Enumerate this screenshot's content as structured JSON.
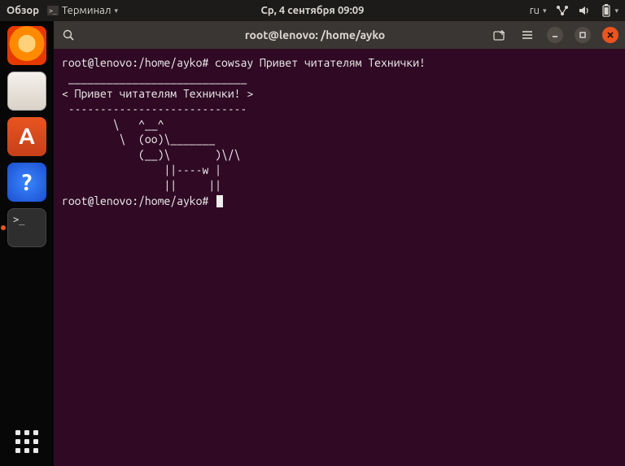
{
  "topbar": {
    "overview": "Обзор",
    "app_label": "Терминал",
    "datetime": "Ср, 4 сентября  09:09",
    "lang": "ru"
  },
  "launcher": {
    "items": [
      {
        "name": "firefox",
        "label": "Firefox"
      },
      {
        "name": "files",
        "label": "Файлы"
      },
      {
        "name": "software",
        "label": "Ubuntu Software",
        "glyph": "A"
      },
      {
        "name": "help",
        "label": "Справка",
        "glyph": "?"
      },
      {
        "name": "terminal",
        "label": "Терминал",
        "glyph": ">_",
        "running": true
      }
    ],
    "apps_button": "Показать приложения"
  },
  "window": {
    "title": "root@lenovo: /home/ayko",
    "prompt1": "root@lenovo:/home/ayko# ",
    "command1": "cowsay Привет читателям Технички!",
    "cow_top": " ____________________________",
    "cow_msg": "< Привет читателям Технички! >",
    "cow_bot": " ----------------------------",
    "cow_a1": "        \\   ^__^",
    "cow_a2": "         \\  (oo)\\_______",
    "cow_a3": "            (__)\\       )\\/\\",
    "cow_a4": "                ||----w |",
    "cow_a5": "                ||     ||",
    "prompt2": "root@lenovo:/home/ayko# "
  }
}
